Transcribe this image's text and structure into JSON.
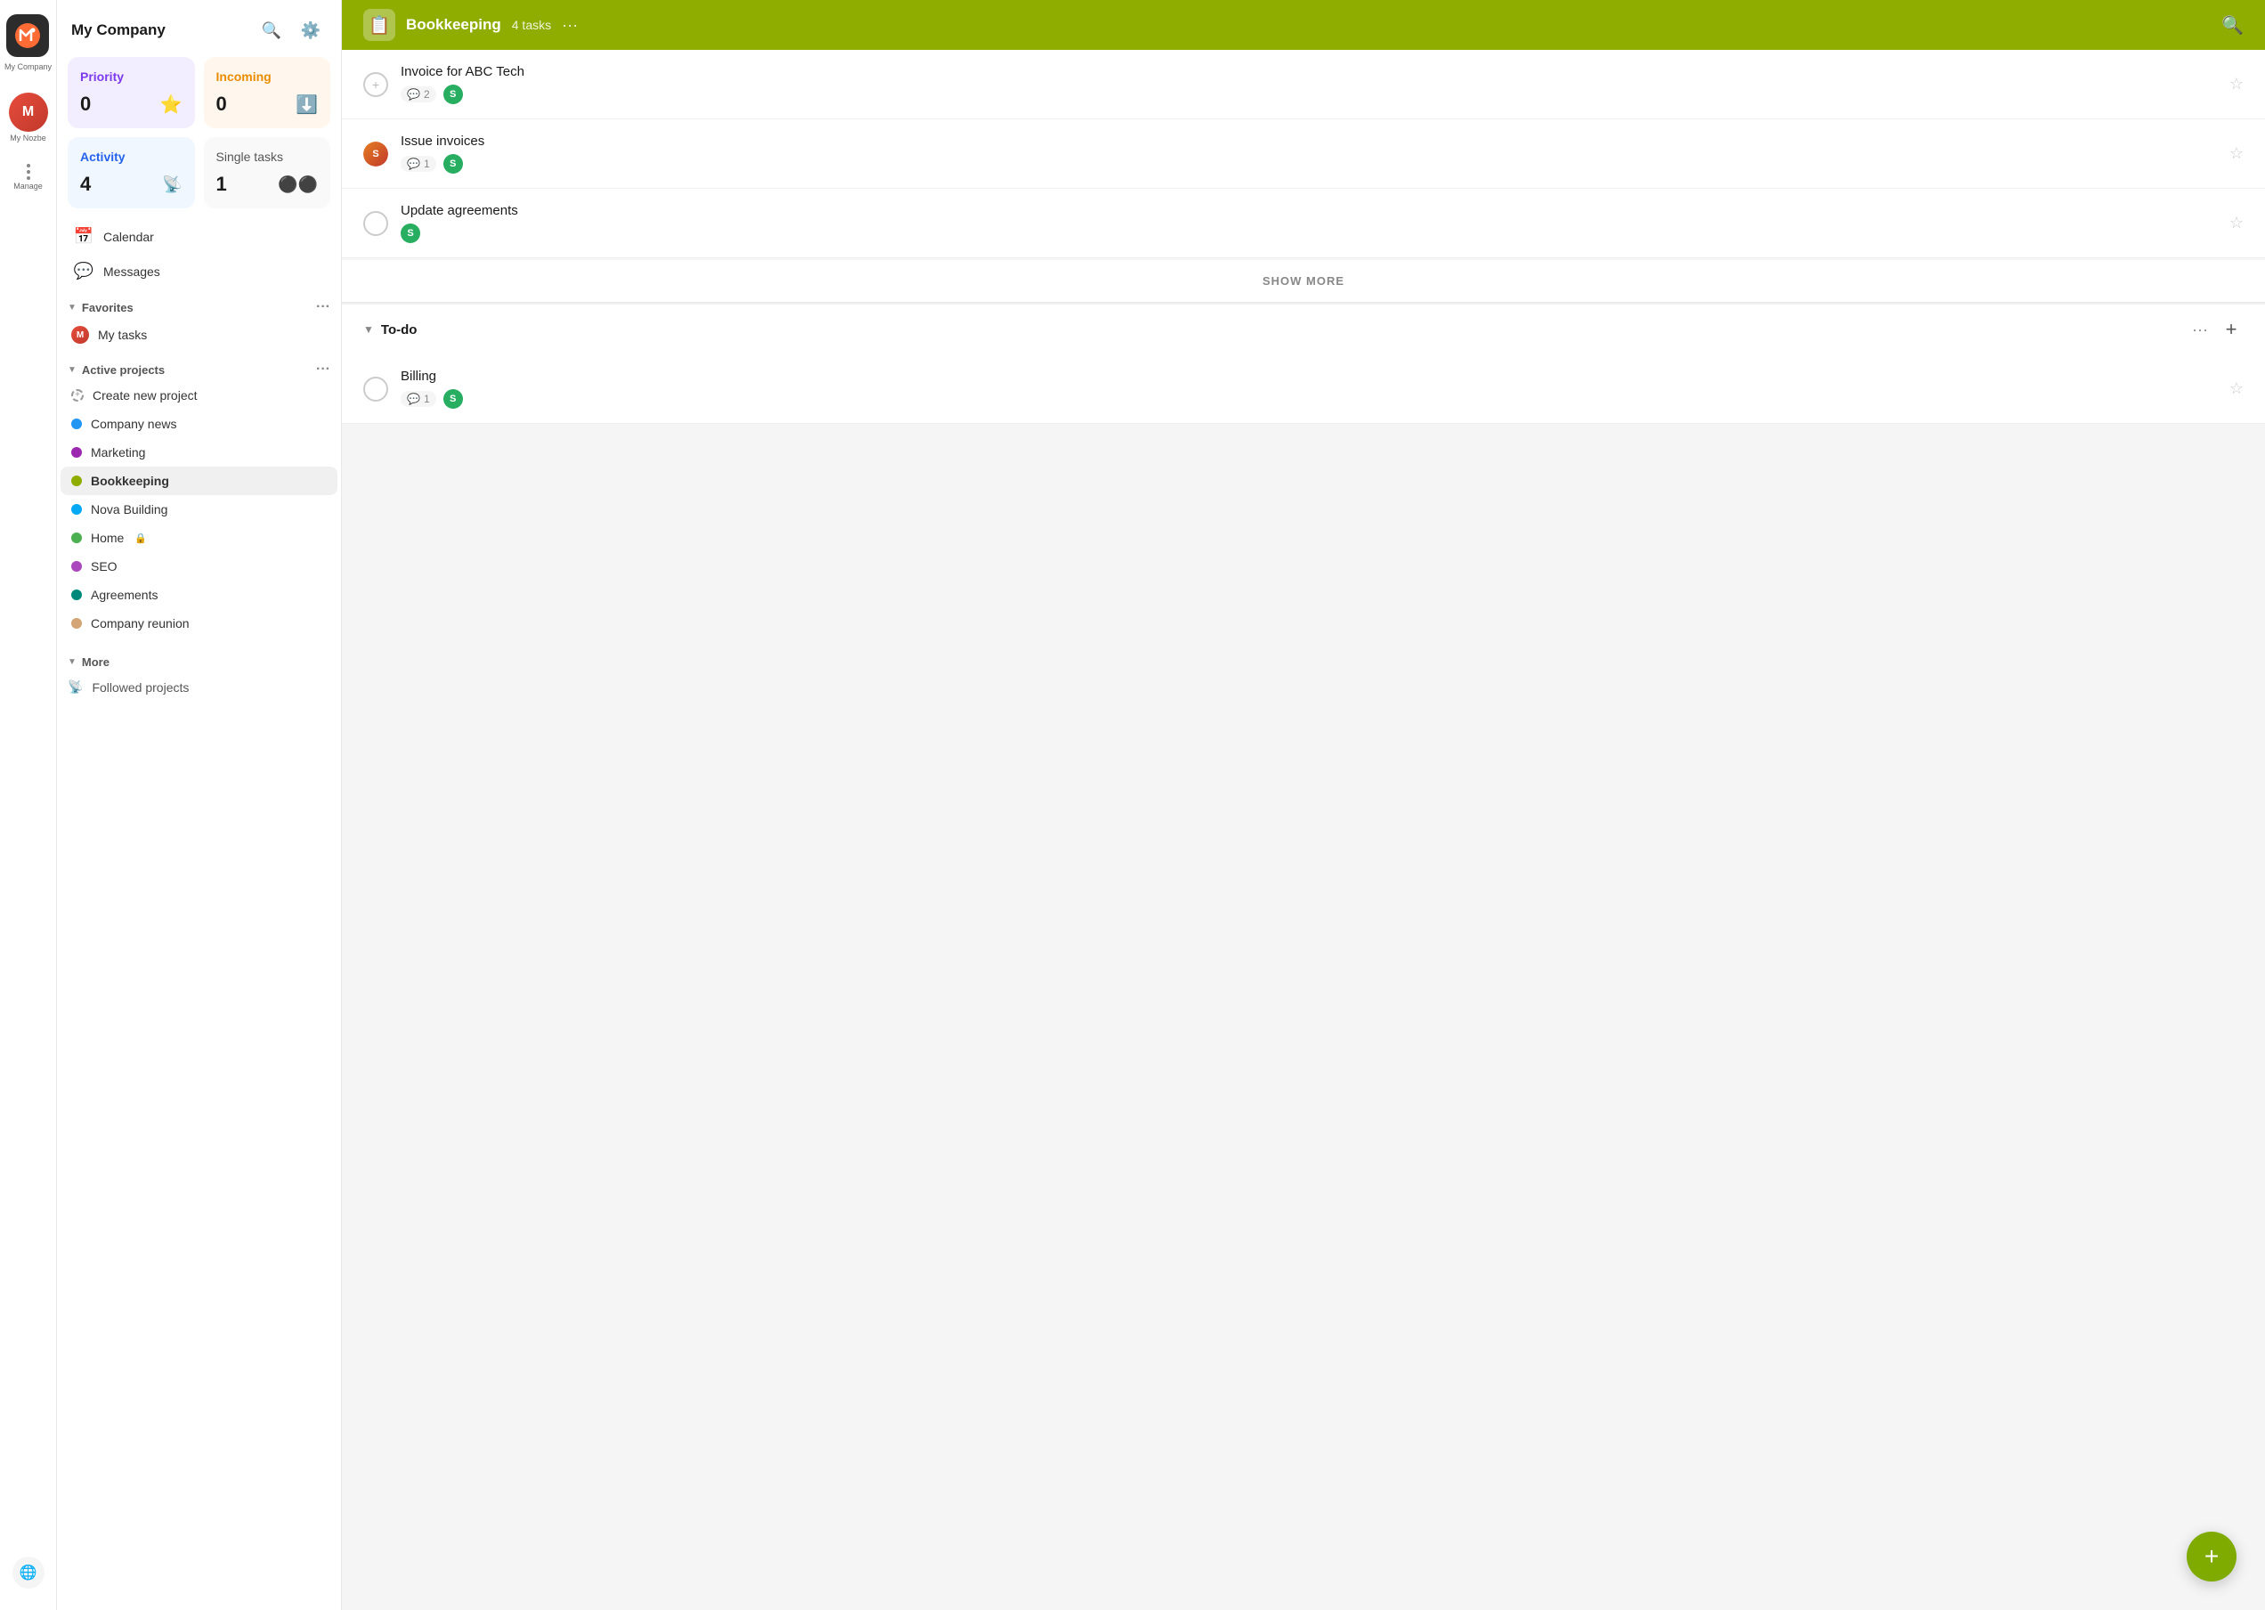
{
  "app": {
    "name": "My Company",
    "logo_text": "N"
  },
  "icon_bar": {
    "logo_alt": "Nozbe logo",
    "my_nozbe_label": "My Nozbe",
    "manage_label": "Manage"
  },
  "sidebar": {
    "title": "My Company",
    "search_tooltip": "Search",
    "settings_tooltip": "Settings",
    "priority": {
      "label": "Priority",
      "count": "0",
      "icon": "★"
    },
    "incoming": {
      "label": "Incoming",
      "count": "0",
      "icon": "⬇"
    },
    "activity": {
      "label": "Activity",
      "count": "4"
    },
    "single_tasks": {
      "label": "Single tasks",
      "count": "1"
    },
    "nav_items": [
      {
        "label": "Calendar",
        "icon": "📅"
      },
      {
        "label": "Messages",
        "icon": "💬"
      }
    ],
    "favorites": {
      "label": "Favorites",
      "items": [
        {
          "label": "My tasks",
          "has_avatar": true
        }
      ]
    },
    "active_projects": {
      "label": "Active projects",
      "items": [
        {
          "label": "Create new project",
          "color": null,
          "is_create": true
        },
        {
          "label": "Company news",
          "color": "#2196f3"
        },
        {
          "label": "Marketing",
          "color": "#9c27b0"
        },
        {
          "label": "Bookkeeping",
          "color": "#8fad00",
          "active": true
        },
        {
          "label": "Nova Building",
          "color": "#03a9f4"
        },
        {
          "label": "Home",
          "color": "#4caf50",
          "has_lock": true
        },
        {
          "label": "SEO",
          "color": "#9c27b0"
        },
        {
          "label": "Agreements",
          "color": "#00897b"
        },
        {
          "label": "Company reunion",
          "color": "#d4a574"
        }
      ]
    },
    "more": {
      "label": "More",
      "items": [
        {
          "label": "Followed projects",
          "icon": "📡"
        }
      ]
    }
  },
  "main": {
    "header": {
      "title": "Bookkeeping",
      "task_count": "4 tasks",
      "dots_label": "···"
    },
    "task_groups": [
      {
        "id": "default",
        "tasks": [
          {
            "title": "Invoice for ABC Tech",
            "comments": "2",
            "has_avatar": true,
            "has_s": true,
            "checked": false
          },
          {
            "title": "Issue invoices",
            "comments": "1",
            "has_avatar": true,
            "has_s": true,
            "checked": false,
            "avatar_type": "photo"
          },
          {
            "title": "Update agreements",
            "comments": null,
            "has_avatar": false,
            "has_s": true,
            "checked": false
          }
        ]
      }
    ],
    "show_more_label": "SHOW MORE",
    "todo_section": {
      "title": "To-do",
      "tasks": [
        {
          "title": "Billing",
          "comments": "1",
          "has_avatar": false,
          "has_s": true,
          "checked": false
        }
      ]
    },
    "fab_label": "+"
  }
}
